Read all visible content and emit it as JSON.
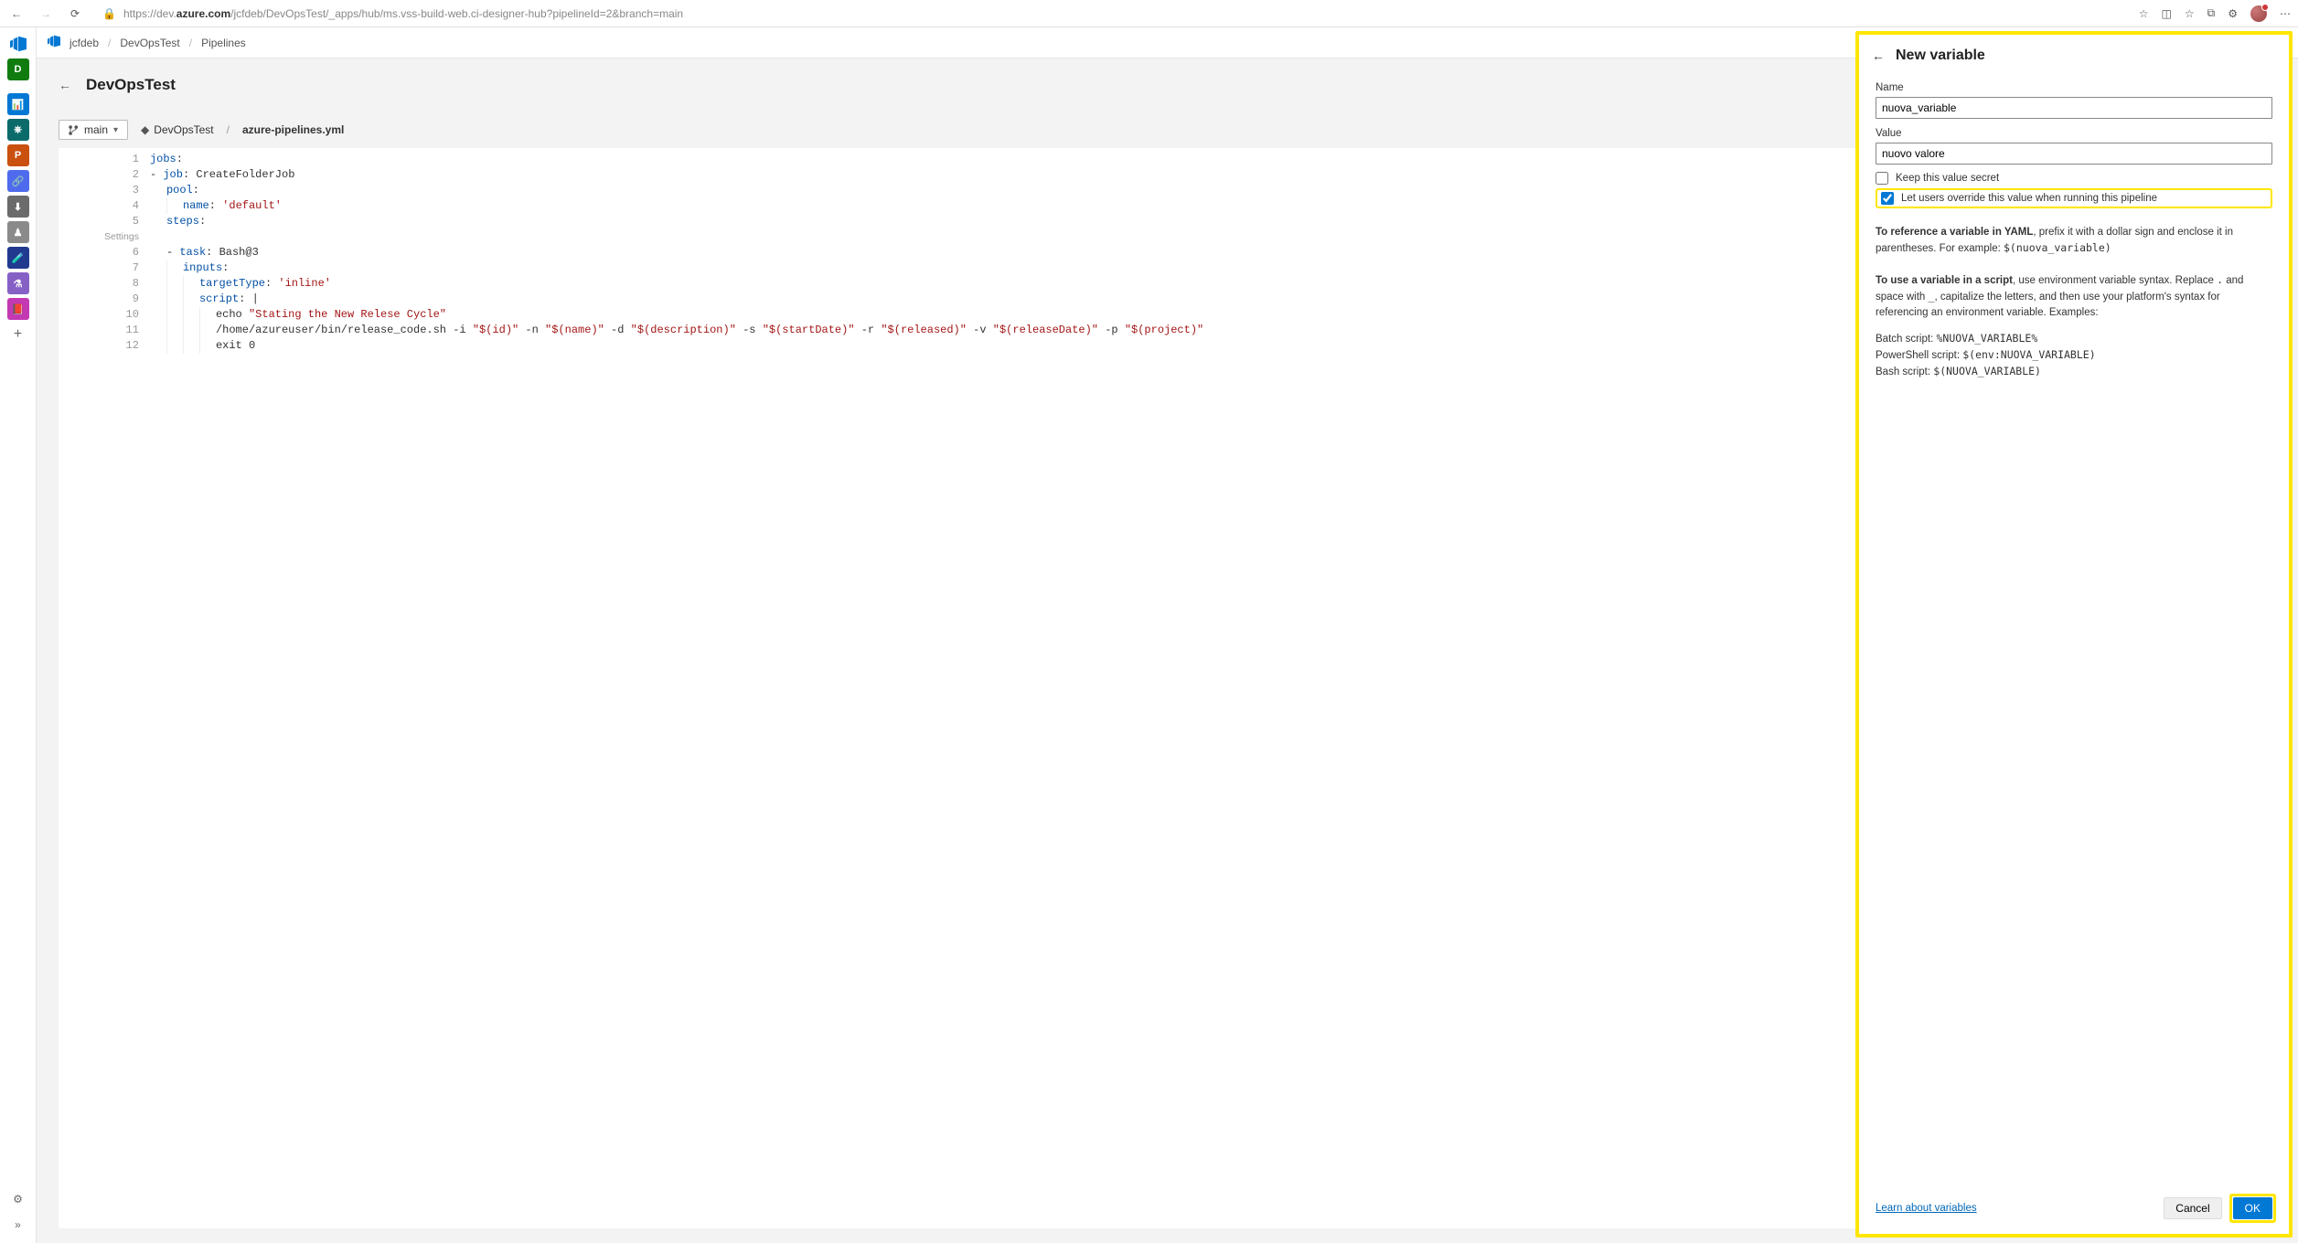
{
  "browser": {
    "url_prefix": "https://",
    "url_host_pre": "dev.",
    "url_host_bold": "azure.com",
    "url_path": "/jcfdeb/DevOpsTest/_apps/hub/ms.vss-build-web.ci-designer-hub?pipelineId=2&branch=main"
  },
  "left_rail": {
    "tiles": [
      {
        "label": "D",
        "bg": "#107c10"
      },
      {
        "label": "",
        "bg": "transparent"
      },
      {
        "label": "📊",
        "bg": "#0078d4"
      },
      {
        "label": "⎈",
        "bg": "#0b6a6a"
      },
      {
        "label": "P",
        "bg": "#ca5010"
      },
      {
        "label": "🔗",
        "bg": "#4f6bed"
      },
      {
        "label": "⬇",
        "bg": "#6b6b6b"
      },
      {
        "label": "♟",
        "bg": "#8a8a8a"
      },
      {
        "label": "🧪",
        "bg": "#213a8f"
      },
      {
        "label": "⚗",
        "bg": "#8661c5"
      },
      {
        "label": "📕",
        "bg": "#c239b3"
      }
    ]
  },
  "crumbs": {
    "org": "jcfdeb",
    "project": "DevOpsTest",
    "section": "Pipelines"
  },
  "page": {
    "title": "DevOpsTest"
  },
  "toolbar": {
    "branch": "main",
    "repo": "DevOpsTest",
    "file": "azure-pipelines.yml"
  },
  "editor": {
    "settings_hint": "Settings",
    "lines": [
      {
        "n": 1,
        "indent": 0,
        "segs": [
          {
            "c": "tok-key",
            "t": "jobs"
          },
          {
            "t": ":"
          }
        ]
      },
      {
        "n": 2,
        "indent": 0,
        "segs": [
          {
            "t": "- "
          },
          {
            "c": "tok-key",
            "t": "job"
          },
          {
            "t": ": "
          },
          {
            "t": "CreateFolderJob"
          }
        ]
      },
      {
        "n": 3,
        "indent": 1,
        "segs": [
          {
            "c": "tok-key",
            "t": "pool"
          },
          {
            "t": ":"
          }
        ]
      },
      {
        "n": 4,
        "indent": 2,
        "segs": [
          {
            "c": "tok-key",
            "t": "name"
          },
          {
            "t": ": "
          },
          {
            "c": "tok-string",
            "t": "'default'"
          }
        ]
      },
      {
        "n": 5,
        "indent": 1,
        "segs": [
          {
            "c": "tok-key",
            "t": "steps"
          },
          {
            "t": ":"
          }
        ]
      },
      {
        "n": "",
        "indent": 0,
        "settings": true
      },
      {
        "n": 6,
        "indent": 1,
        "segs": [
          {
            "t": "- "
          },
          {
            "c": "tok-key",
            "t": "task"
          },
          {
            "t": ": Bash@3"
          }
        ]
      },
      {
        "n": 7,
        "indent": 2,
        "segs": [
          {
            "c": "tok-key",
            "t": "inputs"
          },
          {
            "t": ":"
          }
        ]
      },
      {
        "n": 8,
        "indent": 3,
        "segs": [
          {
            "c": "tok-key",
            "t": "targetType"
          },
          {
            "t": ": "
          },
          {
            "c": "tok-string",
            "t": "'inline'"
          }
        ]
      },
      {
        "n": 9,
        "indent": 3,
        "segs": [
          {
            "c": "tok-key",
            "t": "script"
          },
          {
            "t": ": |"
          }
        ]
      },
      {
        "n": 10,
        "indent": 4,
        "segs": [
          {
            "t": "echo "
          },
          {
            "c": "tok-string",
            "t": "\"Stating the New Relese Cycle\""
          }
        ]
      },
      {
        "n": 11,
        "indent": 4,
        "segs": [
          {
            "t": "/home/azureuser/bin/release_code.sh -i "
          },
          {
            "c": "tok-string",
            "t": "\"$(id)\""
          },
          {
            "t": " -n "
          },
          {
            "c": "tok-string",
            "t": "\"$(name)\""
          },
          {
            "t": " -d "
          },
          {
            "c": "tok-string",
            "t": "\"$(description)\""
          },
          {
            "t": " -s "
          },
          {
            "c": "tok-string",
            "t": "\"$(startDate)\""
          },
          {
            "t": " -r "
          },
          {
            "c": "tok-string",
            "t": "\"$(released)\""
          },
          {
            "t": " -v "
          },
          {
            "c": "tok-string",
            "t": "\"$(releaseDate)\""
          },
          {
            "t": " -p "
          },
          {
            "c": "tok-string",
            "t": "\"$(project)\""
          }
        ]
      },
      {
        "n": 12,
        "indent": 4,
        "segs": [
          {
            "t": "exit 0"
          }
        ]
      }
    ]
  },
  "panel": {
    "title": "New variable",
    "name_label": "Name",
    "name_value": "nuova_variable",
    "value_label": "Value",
    "value_value": "nuovo valore",
    "secret_label": "Keep this value secret",
    "override_label": "Let users override this value when running this pipeline",
    "help_yaml_bold": "To reference a variable in YAML",
    "help_yaml_rest": ", prefix it with a dollar sign and enclose it in parentheses. For example: ",
    "help_yaml_code": "$(nuova_variable)",
    "help_script_bold": "To use a variable in a script",
    "help_script_rest": ", use environment variable syntax. Replace ",
    "help_script_dot": ".",
    "help_script_rest2": " and space with ",
    "help_script_underscore": "_",
    "help_script_rest3": ", capitalize the letters, and then use your platform's syntax for referencing an environment variable. Examples:",
    "batch_label": "Batch script: ",
    "batch_code": "%NUOVA_VARIABLE%",
    "ps_label": "PowerShell script: ",
    "ps_code": "$(env:NUOVA_VARIABLE)",
    "bash_label": "Bash script: ",
    "bash_code": "$(NUOVA_VARIABLE)",
    "learn": "Learn about variables",
    "cancel": "Cancel",
    "ok": "OK"
  }
}
